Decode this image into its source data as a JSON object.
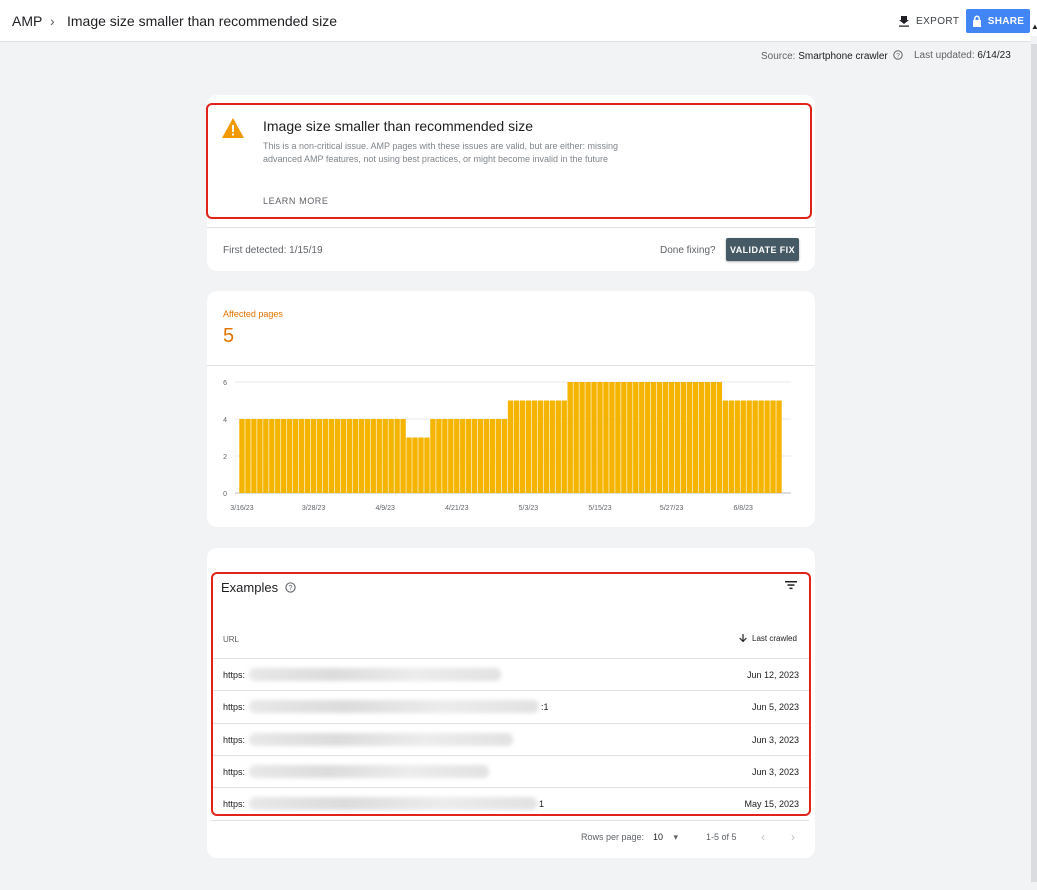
{
  "header": {
    "breadcrumb_root": "AMP",
    "breadcrumb_separator": "›",
    "page_title": "Image size smaller than recommended size",
    "export_label": "EXPORT",
    "share_label": "SHARE",
    "share_color": "#4285f4"
  },
  "meta": {
    "source_label": "Source:",
    "source_value": "Smartphone crawler",
    "updated_label": "Last updated:",
    "updated_value": "6/14/23"
  },
  "issue": {
    "icon": "warning-icon",
    "title": "Image size smaller than recommended size",
    "description": "This is a non-critical issue. AMP pages with these issues are valid, but are either: missing advanced AMP features, not using best practices, or might become invalid in the future",
    "learn_more": "LEARN MORE",
    "first_detected": "First detected: 1/15/19",
    "done_fixing": "Done fixing?",
    "validate_label": "VALIDATE FIX"
  },
  "affected": {
    "label": "Affected pages",
    "count": "5",
    "color": "#e37400"
  },
  "chart_data": {
    "type": "bar",
    "color": "#f4b400",
    "ylim": [
      0,
      6
    ],
    "yticks": [
      0,
      2,
      4,
      6
    ],
    "grid": true,
    "xtick_labels": [
      "3/16/23",
      "3/28/23",
      "4/9/23",
      "4/21/23",
      "5/3/23",
      "5/15/23",
      "5/27/23",
      "6/8/23"
    ],
    "xtick_indices": [
      0,
      12,
      24,
      36,
      48,
      60,
      72,
      84
    ],
    "values": [
      4,
      4,
      4,
      4,
      4,
      4,
      4,
      4,
      4,
      4,
      4,
      4,
      4,
      4,
      4,
      4,
      4,
      4,
      4,
      4,
      4,
      4,
      4,
      4,
      4,
      4,
      4,
      4,
      3,
      3,
      3,
      3,
      4,
      4,
      4,
      4,
      4,
      4,
      4,
      4,
      4,
      4,
      4,
      4,
      4,
      5,
      5,
      5,
      5,
      5,
      5,
      5,
      5,
      5,
      5,
      6,
      6,
      6,
      6,
      6,
      6,
      6,
      6,
      6,
      6,
      6,
      6,
      6,
      6,
      6,
      6,
      6,
      6,
      6,
      6,
      6,
      6,
      6,
      6,
      6,
      6,
      5,
      5,
      5,
      5,
      5,
      5,
      5,
      5,
      5,
      5
    ],
    "title": "",
    "xlabel": "",
    "ylabel": ""
  },
  "examples": {
    "title": "Examples",
    "col_url": "URL",
    "col_last_crawled": "Last crawled",
    "rows": [
      {
        "url_prefix": "https:",
        "url_suffix": "",
        "date": "Jun 12, 2023"
      },
      {
        "url_prefix": "https:",
        "url_suffix": ":1",
        "date": "Jun 5, 2023"
      },
      {
        "url_prefix": "https:",
        "url_suffix": "",
        "date": "Jun 3, 2023"
      },
      {
        "url_prefix": "https:",
        "url_suffix": "",
        "date": "Jun 3, 2023"
      },
      {
        "url_prefix": "https:",
        "url_suffix": "1",
        "date": "May 15, 2023"
      }
    ],
    "rows_per_page_label": "Rows per page:",
    "rows_per_page_value": "10",
    "range": "1-5 of 5"
  }
}
